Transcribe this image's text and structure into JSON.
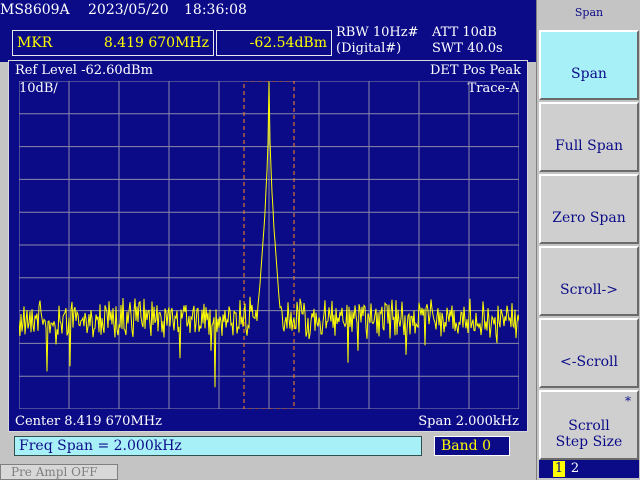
{
  "header": {
    "model": "MS8609A",
    "date": "2023/05/20",
    "time": "18:36:08"
  },
  "marker": {
    "label": "MKR",
    "frequency": "8.419 670MHz",
    "level": "-62.54dBm"
  },
  "settings": {
    "rbw": "RBW 10Hz#",
    "rbw_sub": "(Digital#)",
    "att": "ATT 10dB",
    "swt": "SWT 40.0s"
  },
  "screen": {
    "ref_level": "Ref Level -62.60dBm",
    "scale": "10dB/",
    "det": "DET  Pos Peak",
    "trace": "Trace-A",
    "center": "Center 8.419 670MHz",
    "span": "Span 2.000kHz"
  },
  "entry": {
    "text": "Freq Span = 2.000kHz",
    "band": "Band 0"
  },
  "status": {
    "preamp": "Pre Ampl OFF"
  },
  "softkeys": {
    "title": "Span",
    "items": [
      {
        "label": "Span",
        "active": true
      },
      {
        "label": "Full Span"
      },
      {
        "label": "Zero Span"
      },
      {
        "label": "Scroll->"
      },
      {
        "label": "<-Scroll"
      },
      {
        "label": "Scroll",
        "label2": "Step Size",
        "flag": "*"
      }
    ],
    "pages": [
      "1",
      "2"
    ]
  },
  "colors": {
    "screen_bg": "#0b0b88",
    "trace": "#ffff00",
    "grid": "#8a8aa8",
    "marker_window": "#ff8a1a",
    "active_key": "#a8f0f8"
  },
  "chart_data": {
    "type": "line",
    "x_range": [
      8.41867,
      8.42067
    ],
    "y_range": [
      -162.6,
      -62.6
    ],
    "divisions": {
      "x": 10,
      "y": 10
    },
    "marker": {
      "x": 8.41967,
      "y": -62.54
    },
    "noise_floor_dBm": -135,
    "peak": {
      "x": 8.41967,
      "y": -62.54
    }
  }
}
